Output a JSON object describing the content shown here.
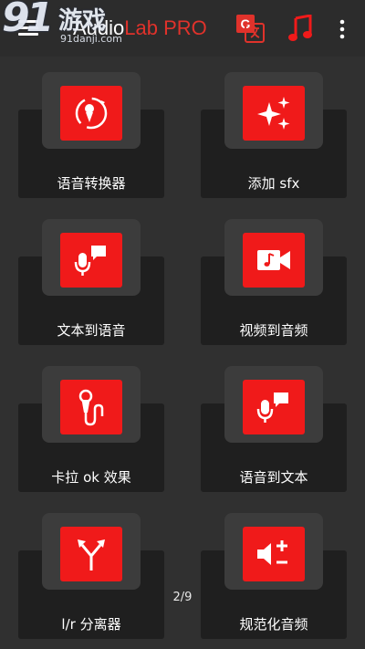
{
  "watermark": {
    "num": "91",
    "cn": "游戏",
    "url": "91danji.com"
  },
  "app": {
    "title_part1": "Audio",
    "title_part2": "Lab PRO"
  },
  "toolbar": {
    "translate_icon": "translate-icon",
    "music_icon": "music-note-icon",
    "more_icon": "more-vert-icon"
  },
  "tiles": [
    {
      "label": "语音转换器",
      "icon": "voice-changer-icon"
    },
    {
      "label": "添加 sfx",
      "icon": "sparkle-icon"
    },
    {
      "label": "文本到语音",
      "icon": "text-to-speech-icon"
    },
    {
      "label": "视频到音频",
      "icon": "video-to-audio-icon"
    },
    {
      "label": "卡拉 ok 效果",
      "icon": "karaoke-mic-icon"
    },
    {
      "label": "语音到文本",
      "icon": "speech-to-text-icon"
    },
    {
      "label": "l/r 分离器",
      "icon": "split-arrows-icon"
    },
    {
      "label": "规范化音频",
      "icon": "normalize-volume-icon"
    }
  ],
  "pager": {
    "indicator": "2/9"
  },
  "colors": {
    "accent": "#f01a1a",
    "background": "#303030",
    "tile_panel": "#1f1f1f"
  }
}
